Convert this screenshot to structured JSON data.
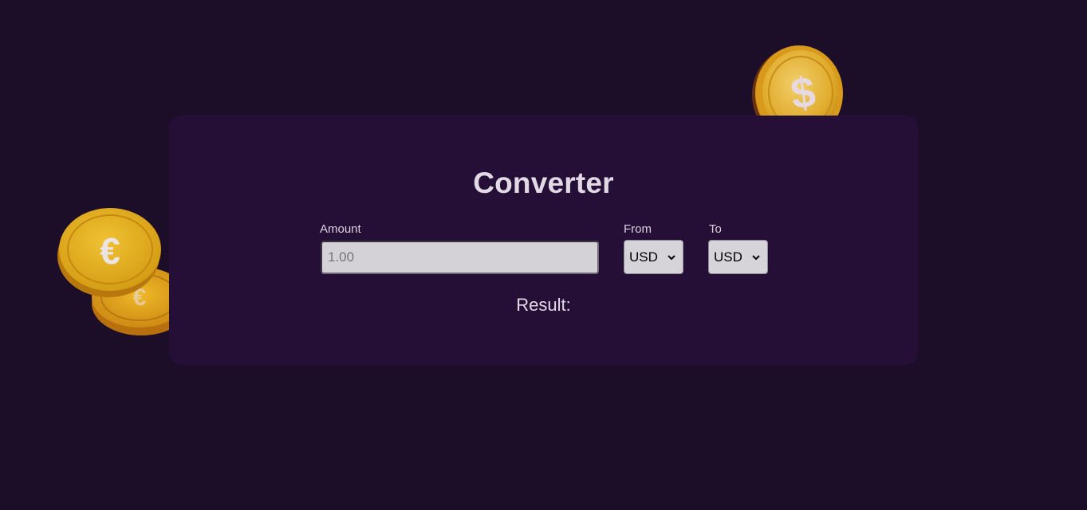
{
  "app": {
    "title": "Converter"
  },
  "form": {
    "amount_label": "Amount",
    "amount_placeholder": "1.00",
    "amount_value": "",
    "from_label": "From",
    "from_selected": "USD",
    "to_label": "To",
    "to_selected": "USD"
  },
  "result": {
    "label": "Result:"
  },
  "decor": {
    "dollar_coin_icon": "dollar-coin-icon",
    "euro_coins_icon": "euro-coins-icon",
    "dollar_symbol": "$",
    "euro_symbol": "€"
  },
  "colors": {
    "page_bg": "#1c0d29",
    "card_bg": "#250f37",
    "gold": "#e4b21c"
  }
}
